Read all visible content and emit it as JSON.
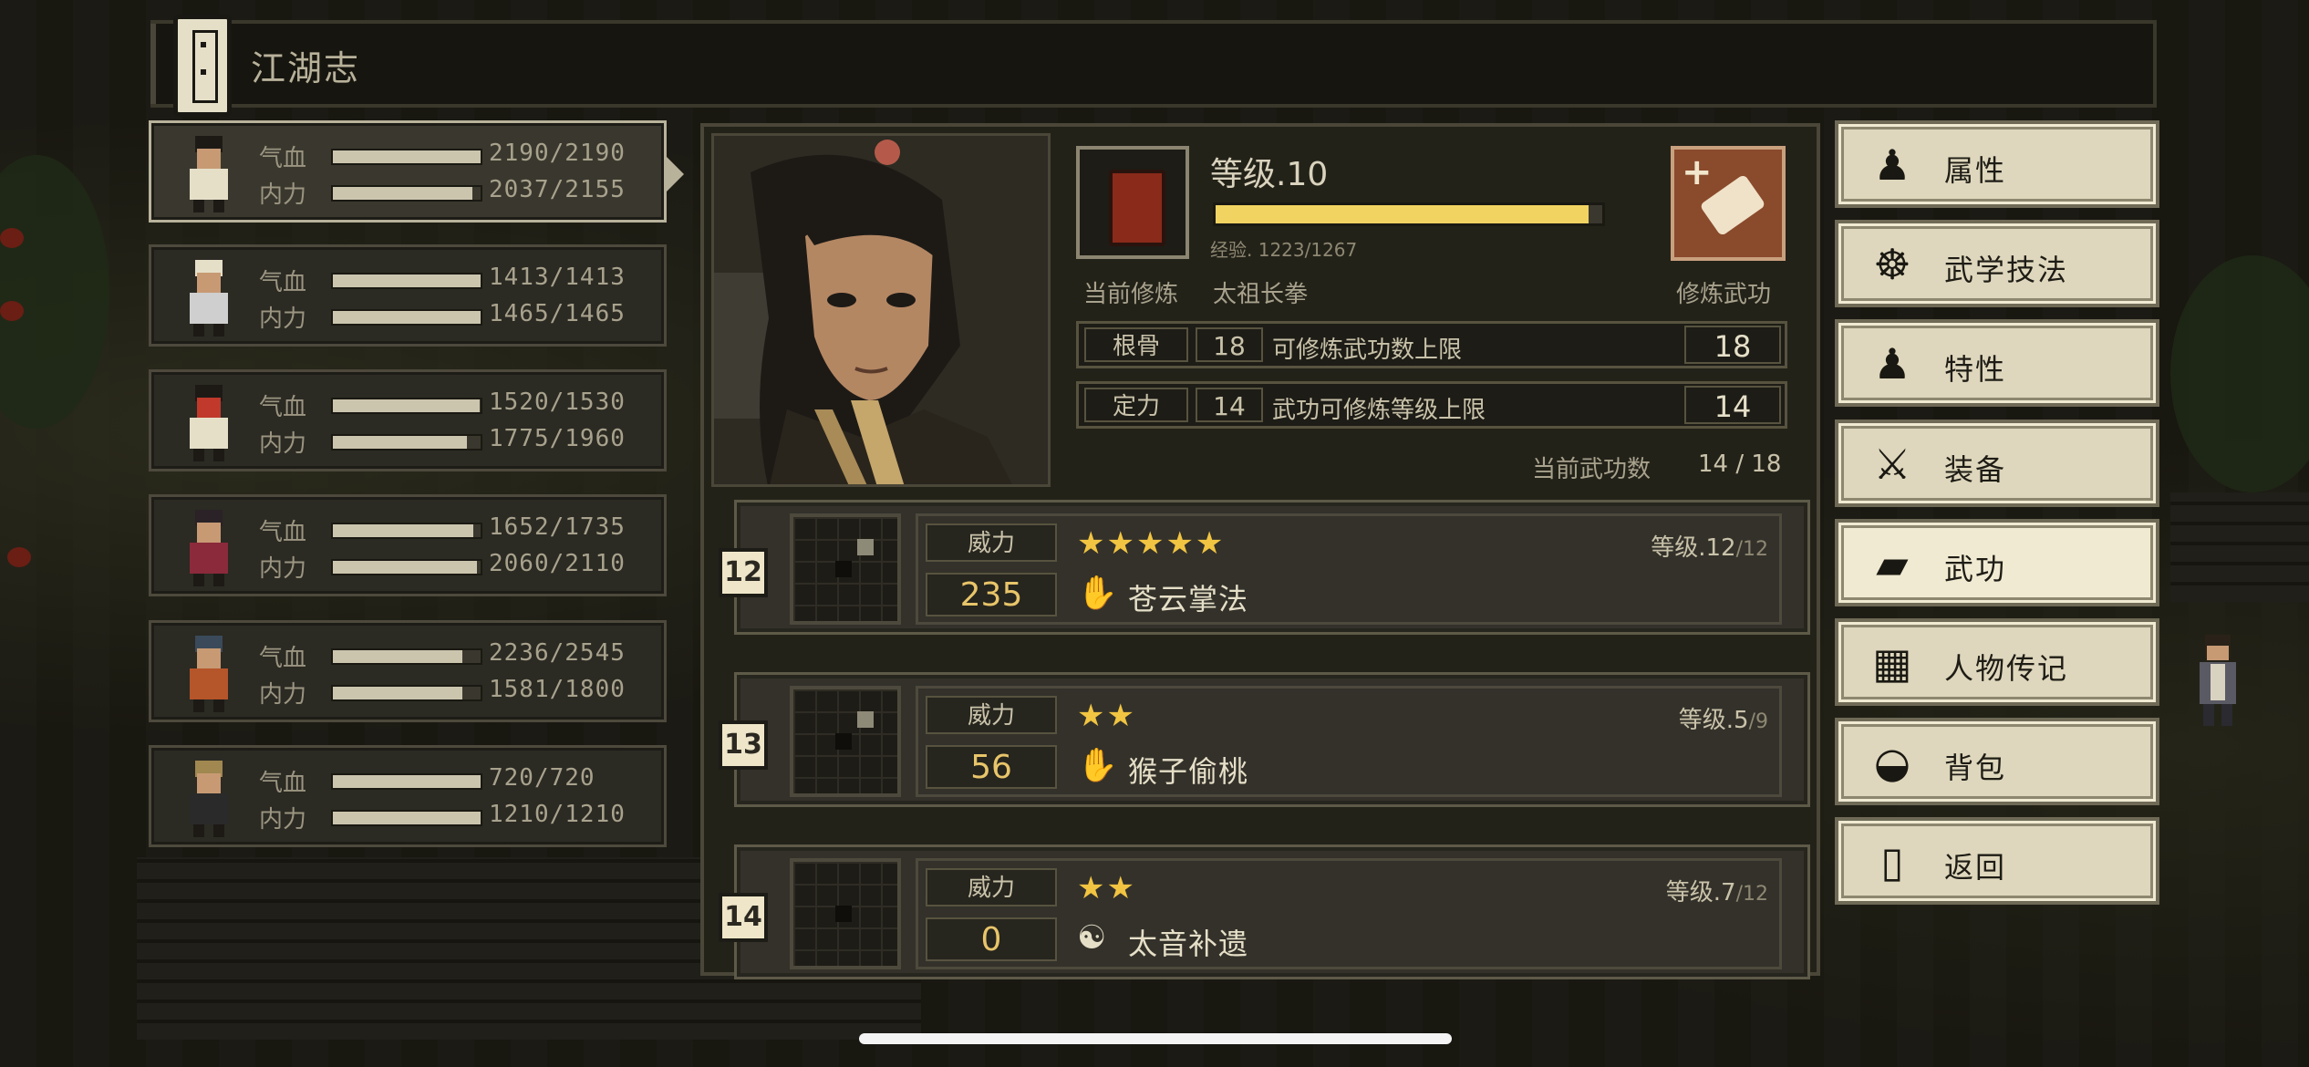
{
  "title": "江湖志",
  "party": [
    {
      "hp_label": "气血",
      "hp": "2190/2190",
      "hp_frac": 1.0,
      "mp_label": "内力",
      "mp": "2037/2155",
      "mp_frac": 0.945,
      "active": true
    },
    {
      "hp_label": "气血",
      "hp": "1413/1413",
      "hp_frac": 1.0,
      "mp_label": "内力",
      "mp": "1465/1465",
      "mp_frac": 1.0,
      "active": false
    },
    {
      "hp_label": "气血",
      "hp": "1520/1530",
      "hp_frac": 0.993,
      "mp_label": "内力",
      "mp": "1775/1960",
      "mp_frac": 0.906,
      "active": false
    },
    {
      "hp_label": "气血",
      "hp": "1652/1735",
      "hp_frac": 0.952,
      "mp_label": "内力",
      "mp": "2060/2110",
      "mp_frac": 0.976,
      "active": false
    },
    {
      "hp_label": "气血",
      "hp": "2236/2545",
      "hp_frac": 0.879,
      "mp_label": "内力",
      "mp": "1581/1800",
      "mp_frac": 0.878,
      "active": false
    },
    {
      "hp_label": "气血",
      "hp": "720/720",
      "hp_frac": 1.0,
      "mp_label": "内力",
      "mp": "1210/1210",
      "mp_frac": 1.0,
      "active": false
    }
  ],
  "detail": {
    "level": "等级.10",
    "exp_text": "经验. 1223/1267",
    "exp_frac": 0.965,
    "current_label": "当前修炼",
    "current_name": "太祖长拳",
    "train_label": "修炼武功",
    "attrs": [
      {
        "name": "根骨",
        "value": "18",
        "desc": "可修炼武功数上限",
        "max": "18"
      },
      {
        "name": "定力",
        "value": "14",
        "desc": "武功可修炼等级上限",
        "max": "14"
      }
    ],
    "count_label": "当前武功数",
    "count_value": "14 / 18"
  },
  "skills": [
    {
      "num": "12",
      "power_label": "威力",
      "power": "235",
      "stars": "★★★★★",
      "icon": "palm-icon",
      "glyph": "✋",
      "name": "苍云掌法",
      "level": "等级.12",
      "level_max": "/12"
    },
    {
      "num": "13",
      "power_label": "威力",
      "power": "56",
      "stars": "★★",
      "icon": "palm-icon",
      "glyph": "✋",
      "name": "猴子偷桃",
      "level": "等级.5",
      "level_max": "/9"
    },
    {
      "num": "14",
      "power_label": "威力",
      "power": "0",
      "stars": "★★",
      "icon": "yinyang-icon",
      "glyph": "☯",
      "name": "太音补遗",
      "level": "等级.7",
      "level_max": "/12"
    }
  ],
  "menu": [
    {
      "label": "属性",
      "icon": "person-icon",
      "glyph": "♟",
      "active": false
    },
    {
      "label": "武学技法",
      "icon": "aura-person-icon",
      "glyph": "☸",
      "active": false
    },
    {
      "label": "特性",
      "icon": "meditate-icon",
      "glyph": "♟",
      "active": false
    },
    {
      "label": "装备",
      "icon": "sword-icon",
      "glyph": "⚔",
      "active": false
    },
    {
      "label": "武功",
      "icon": "book-icon",
      "glyph": "▰",
      "active": true
    },
    {
      "label": "人物传记",
      "icon": "scroll-icon",
      "glyph": "▦",
      "active": false
    },
    {
      "label": "背包",
      "icon": "bag-icon",
      "glyph": "◒",
      "active": false
    },
    {
      "label": "返回",
      "icon": "door-icon",
      "glyph": "▯",
      "active": false
    }
  ],
  "colors": {
    "gold": "#f1d362",
    "power": "#e8c56a",
    "star": "#f1c442",
    "panel": "#232219",
    "menu_bg": "#ded7bd"
  }
}
